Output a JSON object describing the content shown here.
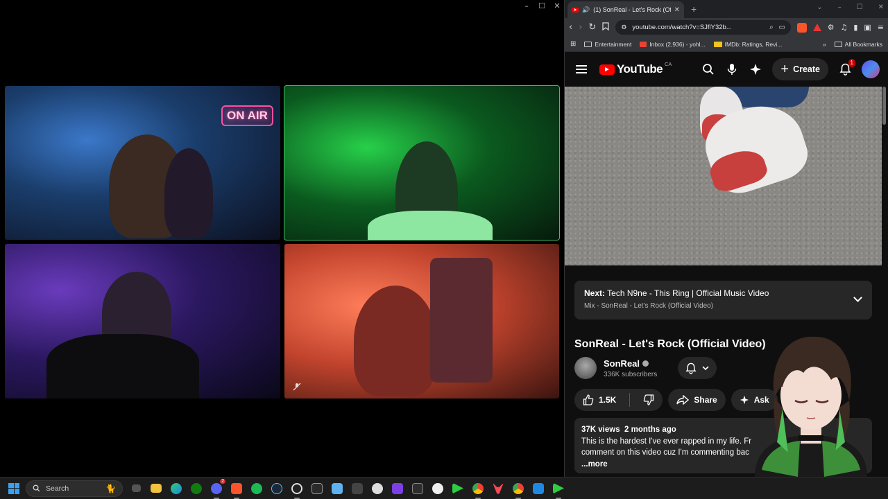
{
  "call_window": {
    "controls": [
      "–",
      "☐",
      "✕"
    ],
    "tiles": [
      {
        "name": "tile-1",
        "sign": "ON AIR"
      },
      {
        "name": "tile-2"
      },
      {
        "name": "tile-3"
      },
      {
        "name": "tile-4"
      }
    ]
  },
  "browser": {
    "tab": {
      "title": "(1) SonReal - Let's Rock (Offici",
      "close": "✕"
    },
    "new_tab": "+",
    "window_controls": [
      "⌄",
      "–",
      "☐",
      "✕"
    ],
    "omnibox": {
      "url": "youtube.com/watch?v=SJflY32b..."
    },
    "bookmarks": [
      {
        "label": "Entertainment",
        "icon": "folder-icon"
      },
      {
        "label": "Inbox (2,936) - yohl...",
        "icon": "gmail-icon"
      },
      {
        "label": "IMDb: Ratings, Revi...",
        "icon": "imdb-icon"
      }
    ],
    "bookmarks_overflow": "»",
    "all_bookmarks": "All Bookmarks"
  },
  "youtube": {
    "logo_text": "YouTube",
    "country": "CA",
    "create_label": "Create",
    "notification_count": "1",
    "up_next": {
      "prefix": "Next:",
      "title": "Tech N9ne - This Ring | Official Music Video",
      "subtitle": "Mix - SonReal - Let's Rock (Official Video)"
    },
    "video_title": "SonReal - Let's Rock (Official Video)",
    "channel": {
      "name": "SonReal",
      "subscribers": "336K subscribers"
    },
    "actions": {
      "likes": "1.5K",
      "share": "Share",
      "ask": "Ask"
    },
    "description": {
      "views": "37K views",
      "age": "2 months ago",
      "line1": "This is the hardest I've ever rapped in my life. Fr",
      "line2": "comment on this video cuz I'm commenting bac",
      "more": "...more"
    }
  },
  "taskbar": {
    "search_placeholder": "Search",
    "apps": [
      "task-view",
      "file-explorer",
      "edge",
      "xbox",
      "discord",
      "brave",
      "spotify",
      "steam",
      "obs",
      "epic-games",
      "notepad",
      "calculator",
      "chatgpt",
      "video-editor",
      "terminal",
      "steelseries",
      "greenshot",
      "chrome",
      "valorant",
      "chrome-2",
      "app-blue",
      "greenshot-2"
    ],
    "discord_badge": "2"
  },
  "colors": {
    "yt_red": "#ff0000",
    "surface": "#272727",
    "bg": "#0f0f0f",
    "active_speaker": "#3fbf66"
  }
}
